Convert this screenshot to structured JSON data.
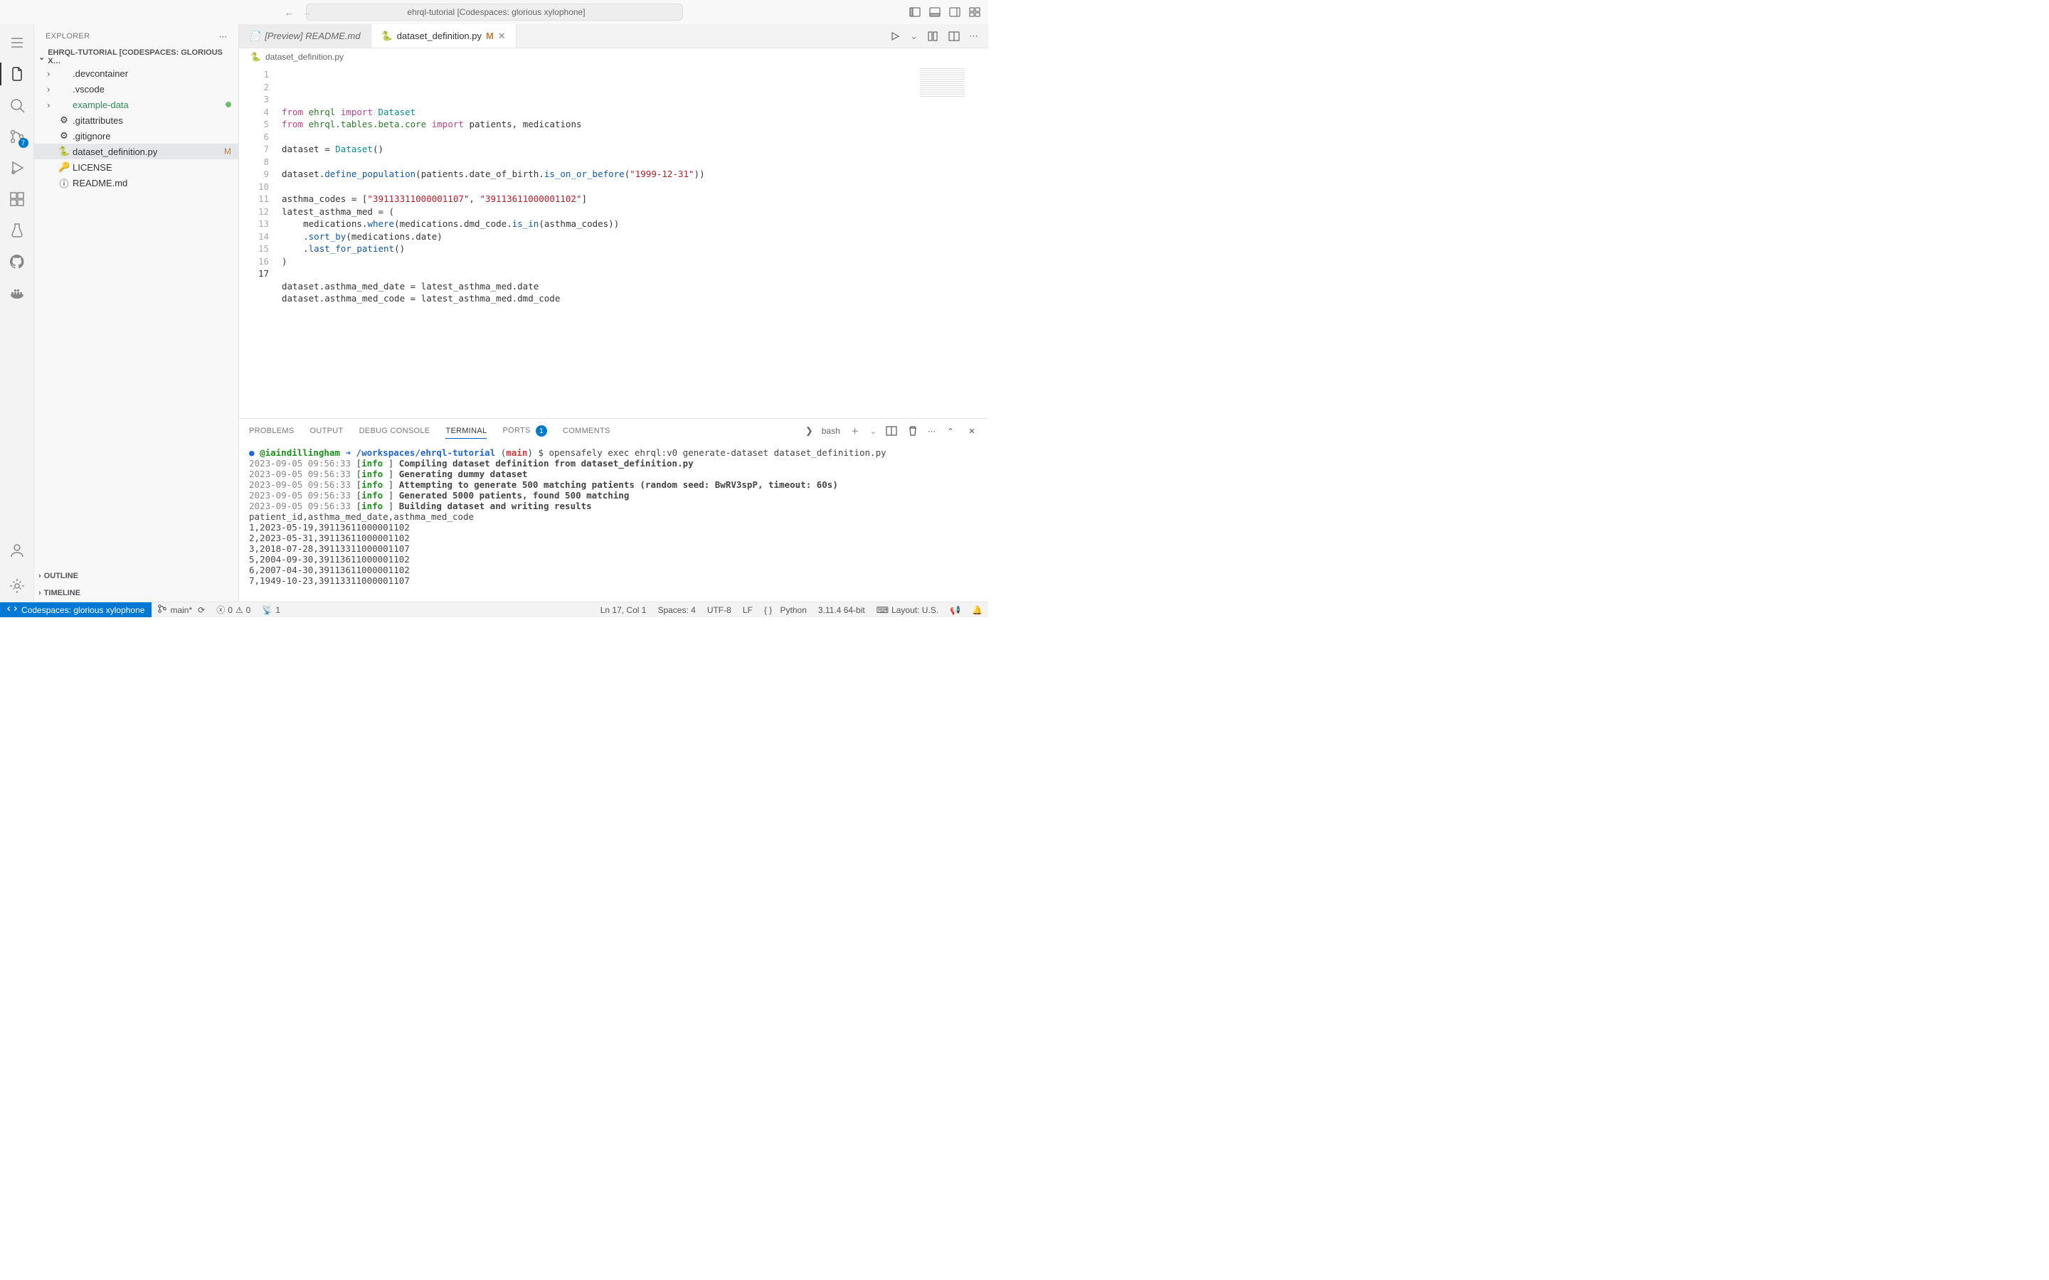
{
  "titlebar": {
    "command_center": "ehrql-tutorial [Codespaces: glorious xylophone]"
  },
  "activity": {
    "scm_badge": "7"
  },
  "sidebar": {
    "title": "EXPLORER",
    "section": "EHRQL-TUTORIAL [CODESPACES: GLORIOUS X…",
    "items": [
      {
        "name": ".devcontainer",
        "type": "folder"
      },
      {
        "name": ".vscode",
        "type": "folder"
      },
      {
        "name": "example-data",
        "type": "folder",
        "green": true,
        "dot": true
      },
      {
        "name": ".gitattributes",
        "type": "file",
        "icon": "⚙"
      },
      {
        "name": ".gitignore",
        "type": "file",
        "icon": "⚙"
      },
      {
        "name": "dataset_definition.py",
        "type": "file",
        "icon": "🐍",
        "selected": true,
        "mod": "M"
      },
      {
        "name": "LICENSE",
        "type": "file",
        "icon": "🔑",
        "licenseIcon": true
      },
      {
        "name": "README.md",
        "type": "file",
        "icon": "ⓘ"
      }
    ],
    "outline": "OUTLINE",
    "timeline": "TIMELINE"
  },
  "tabs": [
    {
      "label": "[Preview] README.md",
      "icon": "📄",
      "active": false,
      "italic": true
    },
    {
      "label": "dataset_definition.py",
      "icon": "🐍",
      "active": true,
      "mod": "M"
    }
  ],
  "breadcrumb": "dataset_definition.py",
  "code_lines": [
    [
      [
        "kw",
        "from"
      ],
      [
        "",
        ""
      ],
      [
        "mod",
        "ehrql"
      ],
      [
        "",
        ""
      ],
      [
        "kw",
        "import"
      ],
      [
        "",
        ""
      ],
      [
        "cls",
        "Dataset"
      ]
    ],
    [
      [
        "kw",
        "from"
      ],
      [
        "",
        ""
      ],
      [
        "mod",
        "ehrql.tables.beta.core"
      ],
      [
        "",
        ""
      ],
      [
        "kw",
        "import"
      ],
      [
        "",
        ""
      ],
      [
        "var",
        "patients"
      ],
      [
        "op",
        ", "
      ],
      [
        "var",
        "medications"
      ]
    ],
    [],
    [
      [
        "var",
        "dataset"
      ],
      [
        "op",
        " = "
      ],
      [
        "cls",
        "Dataset"
      ],
      [
        "op",
        "()"
      ]
    ],
    [],
    [
      [
        "var",
        "dataset"
      ],
      [
        "op",
        "."
      ],
      [
        "fn",
        "define_population"
      ],
      [
        "op",
        "("
      ],
      [
        "var",
        "patients"
      ],
      [
        "op",
        "."
      ],
      [
        "var",
        "date_of_birth"
      ],
      [
        "op",
        "."
      ],
      [
        "fn",
        "is_on_or_before"
      ],
      [
        "op",
        "("
      ],
      [
        "str",
        "\"1999-12-31\""
      ],
      [
        "op",
        "))"
      ]
    ],
    [],
    [
      [
        "var",
        "asthma_codes"
      ],
      [
        "op",
        " = ["
      ],
      [
        "str",
        "\"39113311000001107\""
      ],
      [
        "op",
        ", "
      ],
      [
        "str",
        "\"39113611000001102\""
      ],
      [
        "op",
        "]"
      ]
    ],
    [
      [
        "var",
        "latest_asthma_med"
      ],
      [
        "op",
        " = ("
      ]
    ],
    [
      [
        "",
        "    "
      ],
      [
        "var",
        "medications"
      ],
      [
        "op",
        "."
      ],
      [
        "fn",
        "where"
      ],
      [
        "op",
        "("
      ],
      [
        "var",
        "medications"
      ],
      [
        "op",
        "."
      ],
      [
        "var",
        "dmd_code"
      ],
      [
        "op",
        "."
      ],
      [
        "fn",
        "is_in"
      ],
      [
        "op",
        "("
      ],
      [
        "var",
        "asthma_codes"
      ],
      [
        "op",
        "))"
      ]
    ],
    [
      [
        "",
        "    "
      ],
      [
        "op",
        "."
      ],
      [
        "fn",
        "sort_by"
      ],
      [
        "op",
        "("
      ],
      [
        "var",
        "medications"
      ],
      [
        "op",
        "."
      ],
      [
        "var",
        "date"
      ],
      [
        "op",
        ")"
      ]
    ],
    [
      [
        "",
        "    "
      ],
      [
        "op",
        "."
      ],
      [
        "fn",
        "last_for_patient"
      ],
      [
        "op",
        "()"
      ]
    ],
    [
      [
        "op",
        ")"
      ]
    ],
    [],
    [
      [
        "var",
        "dataset"
      ],
      [
        "op",
        "."
      ],
      [
        "var",
        "asthma_med_date"
      ],
      [
        "op",
        " = "
      ],
      [
        "var",
        "latest_asthma_med"
      ],
      [
        "op",
        "."
      ],
      [
        "var",
        "date"
      ]
    ],
    [
      [
        "var",
        "dataset"
      ],
      [
        "op",
        "."
      ],
      [
        "var",
        "asthma_med_code"
      ],
      [
        "op",
        " = "
      ],
      [
        "var",
        "latest_asthma_med"
      ],
      [
        "op",
        "."
      ],
      [
        "var",
        "dmd_code"
      ]
    ],
    []
  ],
  "panel": {
    "tabs": {
      "problems": "PROBLEMS",
      "output": "OUTPUT",
      "debug": "DEBUG CONSOLE",
      "terminal": "TERMINAL",
      "ports": "PORTS",
      "ports_badge": "1",
      "comments": "COMMENTS"
    },
    "shell": "bash",
    "prompt": {
      "user": "@iaindillingham",
      "arrow": "➜",
      "path": "/workspaces/ehrql-tutorial",
      "branch": "main",
      "command": "opensafely exec ehrql:v0 generate-dataset dataset_definition.py"
    },
    "log_time": "2023-09-05 09:56:33",
    "log_lines": [
      "Compiling dataset definition from dataset_definition.py",
      "Generating dummy dataset",
      "Attempting to generate 500 matching patients (random seed: BwRV3spP, timeout: 60s)",
      "Generated 5000 patients, found 500 matching",
      "Building dataset and writing results"
    ],
    "output_lines": [
      "patient_id,asthma_med_date,asthma_med_code",
      "1,2023-05-19,39113611000001102",
      "2,2023-05-31,39113611000001102",
      "3,2018-07-28,39113311000001107",
      "5,2004-09-30,39113611000001102",
      "6,2007-04-30,39113611000001102",
      "7,1949-10-23,39113311000001107"
    ]
  },
  "statusbar": {
    "remote": "Codespaces: glorious xylophone",
    "branch": "main*",
    "errors": "0",
    "warnings": "0",
    "ports": "1",
    "position": "Ln 17, Col 1",
    "spaces": "Spaces: 4",
    "encoding": "UTF-8",
    "eol": "LF",
    "language": "Python",
    "interpreter": "3.11.4 64-bit",
    "layout": "Layout: U.S."
  }
}
